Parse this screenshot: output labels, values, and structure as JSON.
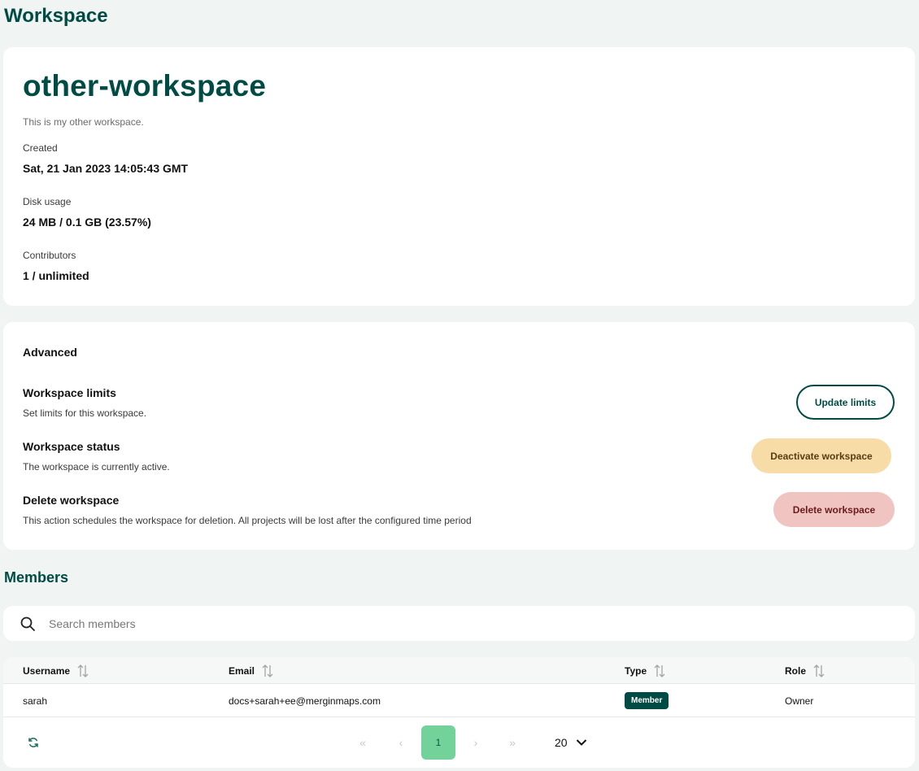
{
  "page": {
    "title": "Workspace"
  },
  "workspace": {
    "name": "other-workspace",
    "description": "This is my other workspace.",
    "created_label": "Created",
    "created_value": "Sat, 21 Jan 2023 14:05:43 GMT",
    "disk_label": "Disk usage",
    "disk_value": "24 MB / 0.1 GB (23.57%)",
    "contributors_label": "Contributors",
    "contributors_value": "1 / unlimited"
  },
  "advanced": {
    "title": "Advanced",
    "limits_title": "Workspace limits",
    "limits_desc": "Set limits for this workspace.",
    "limits_button": "Update limits",
    "status_title": "Workspace status",
    "status_desc": "The workspace is currently active.",
    "status_button": "Deactivate workspace",
    "delete_title": "Delete workspace",
    "delete_desc": "This action schedules the workspace for deletion. All projects will be lost after the configured time period",
    "delete_button": "Delete workspace"
  },
  "members": {
    "title": "Members",
    "search_placeholder": "Search members",
    "columns": [
      "Username",
      "Email",
      "Type",
      "Role"
    ],
    "rows": [
      {
        "username": "sarah",
        "email": "docs+sarah+ee@merginmaps.com",
        "type": "Member",
        "role": "Owner"
      }
    ],
    "pagination": {
      "first": "«",
      "prev": "‹",
      "page": "1",
      "next": "›",
      "last": "»",
      "rows_per_page": "20"
    }
  },
  "colors": {
    "brand": "#004c45",
    "background": "#f0f4f2",
    "warning": "#f8dca8",
    "danger": "#f0c4c1",
    "active_page": "#73d19a"
  },
  "icons": [
    "search-icon",
    "sort-icon",
    "refresh-icon",
    "chevron-down-icon"
  ]
}
